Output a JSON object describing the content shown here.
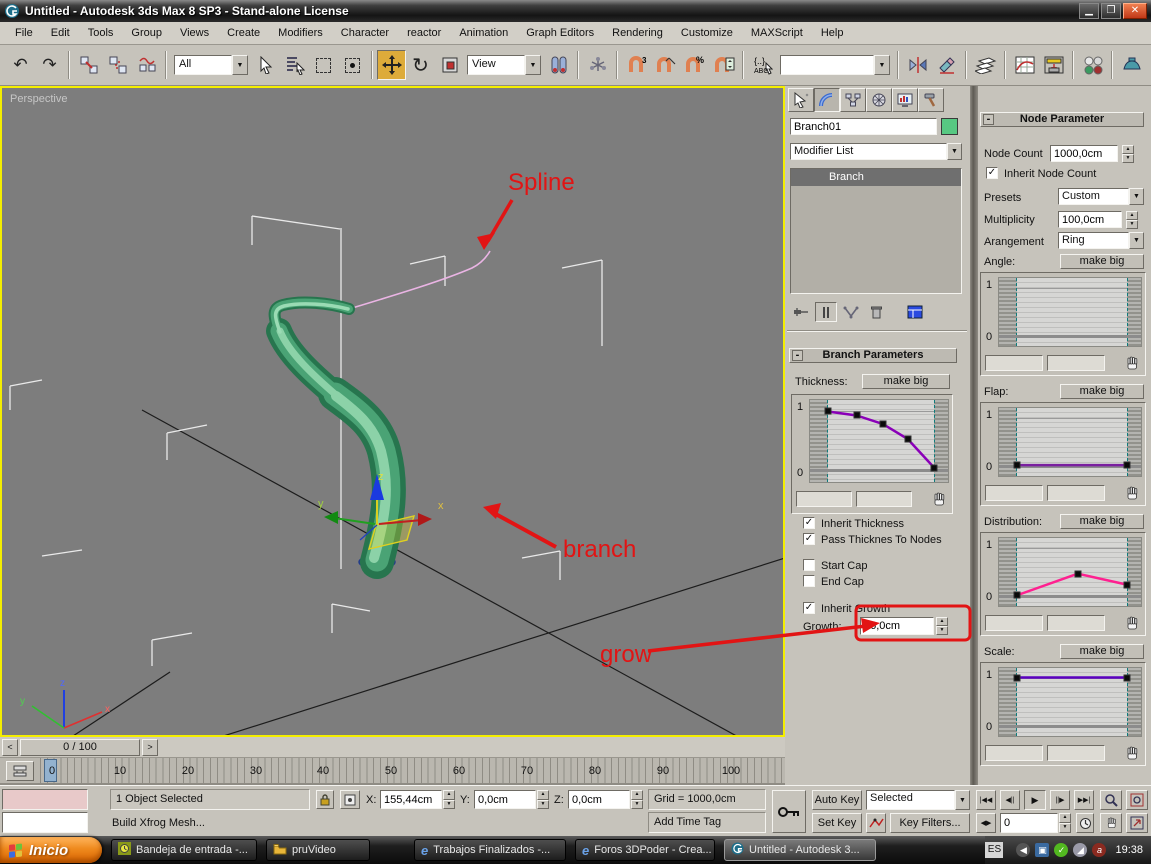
{
  "window": {
    "title": "Untitled - Autodesk 3ds Max 8 SP3  - Stand-alone License"
  },
  "menu": {
    "items": [
      "File",
      "Edit",
      "Tools",
      "Group",
      "Views",
      "Create",
      "Modifiers",
      "Character",
      "reactor",
      "Animation",
      "Graph Editors",
      "Rendering",
      "Customize",
      "MAXScript",
      "Help"
    ]
  },
  "toolbar": {
    "selection_filter": "All",
    "reference_coordinate": "View",
    "named_selection": ""
  },
  "viewport": {
    "label": "Perspective",
    "annotations": {
      "spline": "Spline",
      "branch": "branch",
      "grow": "grow"
    },
    "gizmo_axes": {
      "x": "x",
      "y": "y",
      "z": "z"
    },
    "tripod_axes": {
      "x": "x",
      "y": "y",
      "z": "z"
    }
  },
  "command_panel": {
    "object_name": "Branch01",
    "modifier_list": "Modifier List",
    "stack_items": [
      "Branch"
    ],
    "make_big": "make big",
    "graph_one": "1",
    "graph_zero": "0",
    "branch_parameters": {
      "title": "Branch Parameters",
      "collapse": "-",
      "thickness_label": "Thickness:",
      "graph": {
        "curve": [
          [
            0,
            1
          ],
          [
            0.27,
            0.93
          ],
          [
            0.52,
            0.78
          ],
          [
            0.75,
            0.52
          ],
          [
            1,
            0.02
          ]
        ],
        "color": "#8a00b8"
      },
      "checkboxes": [
        {
          "label": "Inherit Thickness",
          "mark": "✓"
        },
        {
          "label": "Pass Thicknes To Nodes",
          "mark": "✓"
        },
        {
          "label": "Start Cap",
          "mark": ""
        },
        {
          "label": "End Cap",
          "mark": ""
        },
        {
          "label": "Inherit Growth",
          "mark": "✓"
        }
      ],
      "growth_label": "Growth:",
      "growth_value": "86,0cm"
    },
    "node_parameter": {
      "title": "Node Parameter",
      "collapse": "-",
      "node_count_label": "Node Count",
      "node_count_value": "1000,0cm",
      "inherit_node_count": "Inherit Node Count",
      "inherit_mark": "✓",
      "presets_label": "Presets",
      "presets_value": "Custom",
      "multiplicity_label": "Multiplicity",
      "multiplicity_value": "100,0cm",
      "arangement_label": "Arangement",
      "arangement_value": "Ring",
      "sections": [
        {
          "label": "Angle:",
          "curve": [],
          "color": "#888888"
        },
        {
          "label": "Flap:",
          "curve": [
            [
              0,
              0
            ],
            [
              1,
              0
            ]
          ],
          "color": "#7a1fa0"
        },
        {
          "label": "Distribution:",
          "curve": [
            [
              0,
              0
            ],
            [
              0.55,
              0.45
            ],
            [
              1,
              0.22
            ]
          ],
          "color": "#ff2090"
        },
        {
          "label": "Scale:",
          "curve": [
            [
              0,
              1
            ],
            [
              1,
              1
            ]
          ],
          "color": "#5a00c0"
        }
      ]
    }
  },
  "timeline": {
    "time_display": "0 / 100",
    "prev": "<",
    "next": ">",
    "ticks": [
      "0",
      "10",
      "20",
      "30",
      "40",
      "50",
      "60",
      "70",
      "80",
      "90",
      "100"
    ]
  },
  "status_bar": {
    "selection_status": "1 Object Selected",
    "x_label": "X:",
    "x_value": "155,44cm",
    "y_label": "Y:",
    "y_value": "0,0cm",
    "z_label": "Z:",
    "z_value": "0,0cm",
    "grid": "Grid = 1000,0cm",
    "prompt": "Build Xfrog Mesh...",
    "add_time_tag": "Add Time Tag",
    "auto_key": "Auto Key",
    "set_key": "Set Key",
    "key_mode_selected": "Selected",
    "key_filters": "Key Filters...",
    "frame_field": "0"
  },
  "taskbar": {
    "start": "Inicio",
    "tasks": [
      {
        "label": "Bandeja de entrada -..."
      },
      {
        "label": "pruVideo"
      },
      {
        "label": "Trabajos Finalizados -..."
      },
      {
        "label": "Foros 3DPoder - Crea..."
      },
      {
        "label": "Untitled - Autodesk 3..."
      }
    ],
    "tray": {
      "language": "ES",
      "time": "19:38"
    }
  }
}
